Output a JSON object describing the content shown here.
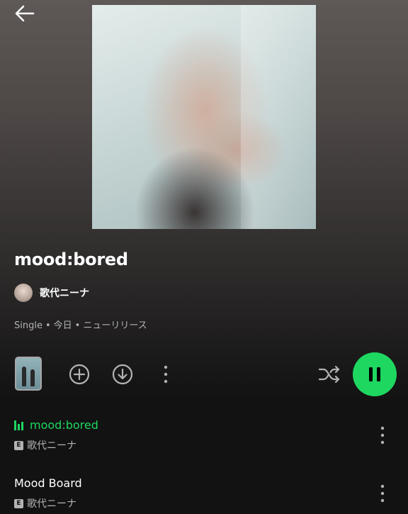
{
  "header": {
    "back_icon": "arrow-left-icon"
  },
  "album": {
    "title": "mood:bored",
    "artist": "歌代ニーナ",
    "type": "Single",
    "date": "今日",
    "category": "ニューリリース"
  },
  "controls": {
    "add_icon": "plus-circle-icon",
    "download_icon": "download-circle-icon",
    "more_icon": "more-vertical-icon",
    "shuffle_icon": "shuffle-icon",
    "play_state_icon": "pause-icon",
    "accent": "#1ed760"
  },
  "tracks": [
    {
      "title": "mood:bored",
      "artist": "歌代ニーナ",
      "explicit_label": "E",
      "playing": true
    },
    {
      "title": "Mood Board",
      "artist": "歌代ニーナ",
      "explicit_label": "E",
      "playing": false
    }
  ]
}
